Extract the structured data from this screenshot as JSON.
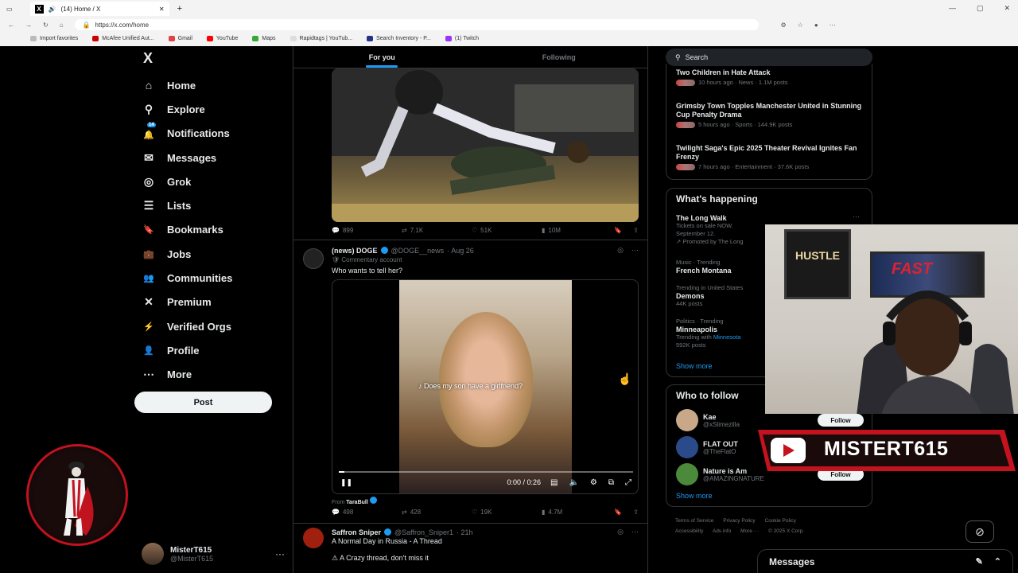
{
  "browser": {
    "tab_title": "(14) Home / X",
    "url": "https://x.com/home",
    "bookmarks": [
      "Import favorites",
      "McAfee Unified Aut...",
      "Gmail",
      "YouTube",
      "Maps",
      "Rapidtags | YouTub...",
      "Search Inventory - P...",
      "(1) Twitch"
    ]
  },
  "sidebar": {
    "logo": "X",
    "items": [
      {
        "label": "Home",
        "icon": "home-icon",
        "glyph": "⌂"
      },
      {
        "label": "Explore",
        "icon": "search-icon",
        "glyph": "⚲"
      },
      {
        "label": "Notifications",
        "icon": "bell-icon",
        "glyph": "🔔",
        "badge": "14"
      },
      {
        "label": "Messages",
        "icon": "mail-icon",
        "glyph": "✉"
      },
      {
        "label": "Grok",
        "icon": "grok-icon",
        "glyph": "◎"
      },
      {
        "label": "Lists",
        "icon": "list-icon",
        "glyph": "☰"
      },
      {
        "label": "Bookmarks",
        "icon": "bookmark-icon",
        "glyph": "🔖"
      },
      {
        "label": "Jobs",
        "icon": "briefcase-icon",
        "glyph": "💼"
      },
      {
        "label": "Communities",
        "icon": "people-icon",
        "glyph": "👥"
      },
      {
        "label": "Premium",
        "icon": "x-premium-icon",
        "glyph": "✕"
      },
      {
        "label": "Verified Orgs",
        "icon": "lightning-icon",
        "glyph": "⚡"
      },
      {
        "label": "Profile",
        "icon": "person-icon",
        "glyph": "👤"
      },
      {
        "label": "More",
        "icon": "more-circle-icon",
        "glyph": "⋯"
      }
    ],
    "post_label": "Post",
    "account_name": "MisterT615",
    "account_handle": "@MisterT615"
  },
  "feed": {
    "tabs": [
      "For you",
      "Following"
    ],
    "tweet1_stats": {
      "replies": "899",
      "reposts": "7.1K",
      "likes": "51K",
      "views": "10M"
    },
    "tweet2": {
      "name": "(news) DOGE",
      "handle": "@DOGE__news",
      "date": "· Aug 26",
      "label": "Commentary account",
      "text": "Who wants to tell her?",
      "video_caption": "Does my son have a girlfriend?",
      "time": "0:00 / 0:26",
      "progress": 0.02,
      "from_label": "From",
      "from_name": "TaraBull",
      "stats": {
        "replies": "498",
        "reposts": "428",
        "likes": "19K",
        "views": "4.7M"
      }
    },
    "tweet3": {
      "name": "Saffron Sniper",
      "handle": "@Saffron_Sniper1",
      "date": "· 21h",
      "line1": "A Normal Day in Russia - A Thread",
      "line2": "A Crazy thread, don't miss it"
    }
  },
  "right": {
    "search_placeholder": "Search",
    "trends_top": [
      {
        "title": "Two Children in Hate Attack",
        "meta": "10 hours ago · News · 1.1M posts"
      },
      {
        "title": "Grimsby Town Topples Manchester United in Stunning Cup Penalty Drama",
        "meta": "5 hours ago · Sports · 144.9K posts"
      },
      {
        "title": "Twilight Saga's Epic 2025 Theater Revival Ignites Fan Frenzy",
        "meta": "7 hours ago · Entertainment · 37.6K posts"
      }
    ],
    "happening_title": "What's happening",
    "happening": [
      {
        "title": "The Long Walk",
        "l1": "Tickets on sale NOW.",
        "l2": "September 12.",
        "l3": "Promoted by The Long"
      },
      {
        "context": "Music · Trending",
        "title": "French Montana"
      },
      {
        "context": "Trending in United States",
        "title": "Demons",
        "count": "44K posts"
      },
      {
        "context": "Politics · Trending",
        "title": "Minneapolis",
        "with": "Trending with",
        "with_link": "Minnesota",
        "count": "592K posts"
      }
    ],
    "show_more": "Show more",
    "who_to_follow_title": "Who to follow",
    "follow": [
      {
        "name": "Kae",
        "handle": "@xSlimezilla"
      },
      {
        "name": "FLAT OUT",
        "handle": "@TheFlatO"
      },
      {
        "name": "Nature is Am",
        "handle": "@AMAZINGNATURE"
      }
    ],
    "follow_label": "Follow",
    "footer_links": [
      "Terms of Service",
      "Privacy Policy",
      "Cookie Policy",
      "Accessibility",
      "Ads info",
      "More ···",
      "© 2025 X Corp."
    ],
    "messages_label": "Messages"
  },
  "overlay": {
    "poster1": "HUSTLE",
    "poster2": "FAST",
    "channel": "MISTERT615"
  },
  "colors": {
    "accent": "#1d9bf0",
    "youtube_red": "#c4121e"
  }
}
